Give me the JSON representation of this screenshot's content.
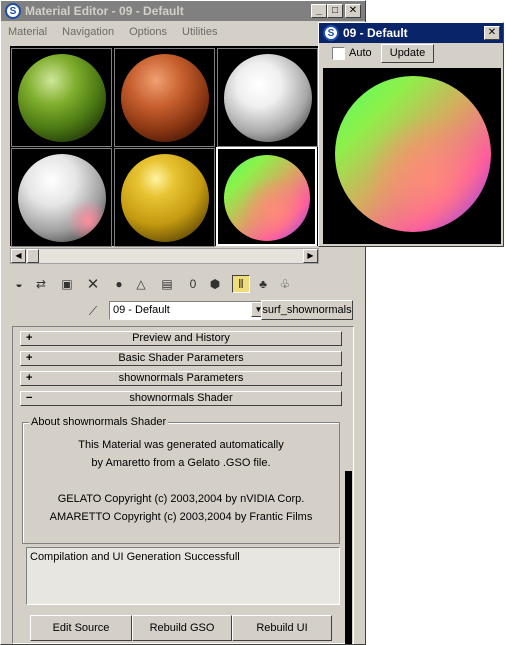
{
  "main_window": {
    "title": "Material Editor - 09 - Default",
    "menu": [
      "Material",
      "Navigation",
      "Options",
      "Utilities"
    ],
    "material_combo": {
      "value": "09 - Default"
    },
    "material_type_button": "surf_shownormals",
    "rollouts": [
      {
        "sign": "+",
        "label": "Preview and History"
      },
      {
        "sign": "+",
        "label": "Basic Shader Parameters"
      },
      {
        "sign": "+",
        "label": "shownormals Parameters"
      },
      {
        "sign": "−",
        "label": "shownormals Shader"
      }
    ],
    "about": {
      "title": "About shownormals Shader",
      "lines": [
        "This Material was generated automatically",
        "by Amaretto from a Gelato .GSO file.",
        "",
        "GELATO   Copyright (c) 2003,2004 by nVIDIA Corp.",
        "AMARETTO Copyright (c) 2003,2004 by Frantic Films"
      ]
    },
    "log_text": "Compilation and UI Generation Successfull",
    "bottom_buttons": [
      "Edit Source",
      "Rebuild GSO",
      "Rebuild UI"
    ],
    "sample_slots": [
      {
        "name": "green-granite",
        "colors": [
          "#cfe69a",
          "#5f8c1d",
          "#1d2b05"
        ]
      },
      {
        "name": "red-rust",
        "colors": [
          "#f0a073",
          "#b2522a",
          "#3c1205"
        ]
      },
      {
        "name": "white-default",
        "colors": [
          "#ffffff",
          "#c8c8c8",
          "#2a2a2a"
        ]
      },
      {
        "name": "white-pink",
        "colors": [
          "#ffffff",
          "#d5d5d5",
          "#ff8ca0"
        ]
      },
      {
        "name": "gold",
        "colors": [
          "#fff3a0",
          "#d2a914",
          "#3a2b00"
        ]
      },
      {
        "name": "shownormals",
        "colors": [
          "#4dff6a",
          "#ff5aa0",
          "#6a3cff"
        ]
      }
    ]
  },
  "preview_window": {
    "title": "09 - Default",
    "auto_label": "Auto",
    "auto_checked": false,
    "update_label": "Update"
  },
  "colors": {
    "title_active": "#0a246a",
    "title_inactive": "#808080",
    "face": "#d4d0c8",
    "pressed_tool": "#f0dc78"
  }
}
